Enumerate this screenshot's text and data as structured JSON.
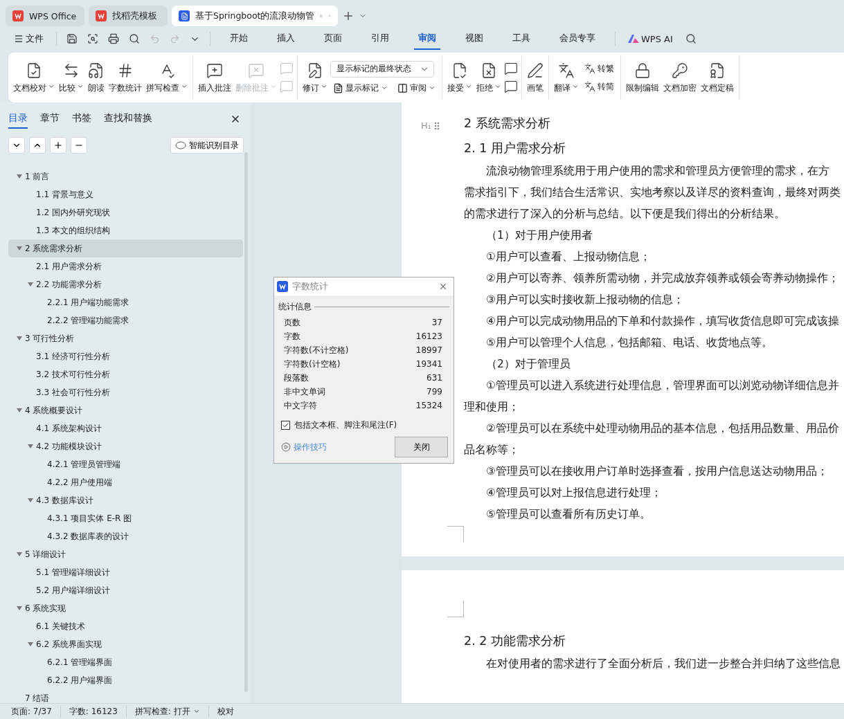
{
  "app_tabs": [
    {
      "label": "WPS Office",
      "kind": "home",
      "selected": false
    },
    {
      "label": "找稻壳模板",
      "kind": "template",
      "selected": false
    },
    {
      "label": "基于Springboot的流浪动物管",
      "kind": "doc",
      "selected": true
    }
  ],
  "menu": {
    "file": "文件",
    "tabs": [
      {
        "label": "开始",
        "selected": false
      },
      {
        "label": "插入",
        "selected": false
      },
      {
        "label": "页面",
        "selected": false
      },
      {
        "label": "引用",
        "selected": false
      },
      {
        "label": "审阅",
        "selected": true
      },
      {
        "label": "视图",
        "selected": false
      },
      {
        "label": "工具",
        "selected": false
      },
      {
        "label": "会员专享",
        "selected": false
      }
    ],
    "ai": "WPS AI"
  },
  "ribbon": [
    {
      "items": [
        {
          "kind": "big",
          "label": "文档校对",
          "dropdown": true,
          "disabled": false
        },
        {
          "kind": "big",
          "label": "比较",
          "dropdown": true,
          "disabled": false
        },
        {
          "kind": "big",
          "label": "朗读",
          "dropdown": false,
          "disabled": false
        },
        {
          "kind": "big",
          "label": "字数统计",
          "dropdown": false,
          "disabled": false
        },
        {
          "kind": "big",
          "label": "拼写检查",
          "dropdown": true,
          "disabled": false
        }
      ]
    },
    {
      "items": [
        {
          "kind": "big",
          "label": "插入批注",
          "dropdown": false,
          "disabled": false
        },
        {
          "kind": "big",
          "label": "删除批注",
          "dropdown": true,
          "disabled": true
        },
        {
          "kind": "pair",
          "disabled": true
        }
      ]
    },
    {
      "items": [
        {
          "kind": "big",
          "label": "修订",
          "dropdown": true,
          "disabled": false
        },
        {
          "kind": "select",
          "value": "显示标记的最终状态",
          "buttons": [
            {
              "label": "显示标记",
              "dropdown": true
            },
            {
              "label": "审阅",
              "dropdown": true
            }
          ]
        }
      ]
    },
    {
      "items": [
        {
          "kind": "big",
          "label": "接受",
          "dropdown": true,
          "disabled": false
        },
        {
          "kind": "big",
          "label": "拒绝",
          "dropdown": true,
          "disabled": false
        },
        {
          "kind": "pair",
          "disabled": false
        }
      ]
    },
    {
      "items": [
        {
          "kind": "big",
          "label": "画笔",
          "dropdown": false,
          "disabled": false
        }
      ]
    },
    {
      "items": [
        {
          "kind": "big",
          "label": "翻译",
          "dropdown": true,
          "disabled": false
        },
        {
          "kind": "stack",
          "buttons": [
            {
              "label": "转繁",
              "dropdown": false
            },
            {
              "label": "转简",
              "dropdown": false
            }
          ]
        }
      ]
    },
    {
      "items": [
        {
          "kind": "big",
          "label": "限制编辑",
          "dropdown": false,
          "disabled": false
        },
        {
          "kind": "big",
          "label": "文档加密",
          "dropdown": false,
          "disabled": false
        },
        {
          "kind": "big",
          "label": "文档定稿",
          "dropdown": false,
          "disabled": false
        }
      ]
    }
  ],
  "nav_panel": {
    "tabs": [
      {
        "label": "目录",
        "selected": true
      },
      {
        "label": "章节",
        "selected": false
      },
      {
        "label": "书签",
        "selected": false
      },
      {
        "label": "查找和替换",
        "selected": false
      }
    ],
    "smart_button": "智能识别目录",
    "toc": [
      {
        "label": "1 前言",
        "expanded": true,
        "selected": false,
        "children": [
          {
            "label": "1.1 背景与意义",
            "selected": false
          },
          {
            "label": "1.2 国内外研究现状",
            "selected": false
          },
          {
            "label": "1.3 本文的组织结构",
            "selected": false
          }
        ]
      },
      {
        "label": "2 系统需求分析",
        "expanded": true,
        "selected": true,
        "children": [
          {
            "label": "2.1 用户需求分析",
            "selected": false
          },
          {
            "label": "2.2 功能需求分析",
            "expanded": true,
            "selected": false,
            "children": [
              {
                "label": "2.2.1 用户端功能需求",
                "selected": false
              },
              {
                "label": "2.2.2 管理端功能需求",
                "selected": false
              }
            ]
          }
        ]
      },
      {
        "label": "3 可行性分析",
        "expanded": true,
        "selected": false,
        "children": [
          {
            "label": "3.1 经济可行性分析",
            "selected": false
          },
          {
            "label": "3.2 技术可行性分析",
            "selected": false
          },
          {
            "label": "3.3 社会可行性分析",
            "selected": false
          }
        ]
      },
      {
        "label": "4 系统概要设计",
        "expanded": true,
        "selected": false,
        "children": [
          {
            "label": "4.1 系统架构设计",
            "selected": false
          },
          {
            "label": "4.2 功能模块设计",
            "expanded": true,
            "selected": false,
            "children": [
              {
                "label": "4.2.1 管理员管理端",
                "selected": false
              },
              {
                "label": "4.2.2 用户使用端",
                "selected": false
              }
            ]
          },
          {
            "label": "4.3 数据库设计",
            "expanded": true,
            "selected": false,
            "children": [
              {
                "label": "4.3.1 项目实体 E-R 图",
                "selected": false
              },
              {
                "label": "4.3.2 数据库表的设计",
                "selected": false
              }
            ]
          }
        ]
      },
      {
        "label": "5 详细设计",
        "expanded": true,
        "selected": false,
        "children": [
          {
            "label": "5.1 管理端详细设计",
            "selected": false
          },
          {
            "label": "5.2 用户端详细设计",
            "selected": false
          }
        ]
      },
      {
        "label": "6  系统实现",
        "expanded": true,
        "selected": false,
        "children": [
          {
            "label": "6.1 关键技术",
            "selected": false
          },
          {
            "label": "6.2 系统界面实现",
            "expanded": true,
            "selected": false,
            "children": [
              {
                "label": "6.2.1 管理端界面",
                "selected": false
              },
              {
                "label": "6.2.2 用户端界面",
                "selected": false
              }
            ]
          }
        ]
      },
      {
        "label": "7 结语",
        "selected": false
      }
    ]
  },
  "document": {
    "heading_marker": "H₁",
    "page1": [
      {
        "kind": "h1",
        "text": "2 系统需求分析"
      },
      {
        "kind": "h2",
        "text": "2. 1 用户需求分析"
      },
      {
        "kind": "indent",
        "text": "流浪动物管理系统用于用户使用的需求和管理员方便管理的需求，在方"
      },
      {
        "kind": "plain",
        "text": "需求指引下，我们结合生活常识、实地考察以及详尽的资料查询，最终对两类"
      },
      {
        "kind": "plain",
        "text": "的需求进行了深入的分析与总结。以下便是我们得出的分析结果。"
      },
      {
        "kind": "indent",
        "text": "（1）对于用户使用者"
      },
      {
        "kind": "indent",
        "text": "①用户可以查看、上报动物信息；"
      },
      {
        "kind": "indent",
        "text": "②用户可以寄养、领养所需动物，并完成放弃领养或领会寄养动物操作；"
      },
      {
        "kind": "indent",
        "text": "③用户可以实时接收新上报动物的信息；"
      },
      {
        "kind": "indent",
        "text": "④用户可以完成动物用品的下单和付款操作，填写收货信息即可完成该操"
      },
      {
        "kind": "indent",
        "text": "⑤用户可以管理个人信息，包括邮箱、电话、收货地点等。"
      },
      {
        "kind": "indent",
        "text": "（2）对于管理员"
      },
      {
        "kind": "indent",
        "text": "①管理员可以进入系统进行处理信息，管理界面可以浏览动物详细信息并"
      },
      {
        "kind": "plain",
        "text": "理和使用；"
      },
      {
        "kind": "indent",
        "text": "②管理员可以在系统中处理动物用品的基本信息，包括用品数量、用品价"
      },
      {
        "kind": "plain",
        "text": "品名称等；"
      },
      {
        "kind": "indent",
        "text": "③管理员可以在接收用户订单时选择查看，按用户信息送达动物用品；"
      },
      {
        "kind": "indent",
        "text": "④管理员可以对上报信息进行处理；"
      },
      {
        "kind": "indent",
        "text": "⑤管理员可以查看所有历史订单。"
      }
    ],
    "page2": [
      {
        "kind": "h2",
        "text": "2. 2 功能需求分析"
      },
      {
        "kind": "indent",
        "text": "在对使用者的需求进行了全面分析后，我们进一步整合并归纳了这些信息"
      }
    ]
  },
  "word_count_dialog": {
    "title": "字数统计",
    "section": "统计信息",
    "rows": [
      {
        "label": "页数",
        "value": "37"
      },
      {
        "label": "字数",
        "value": "16123"
      },
      {
        "label": "字符数(不计空格)",
        "value": "18997"
      },
      {
        "label": "字符数(计空格)",
        "value": "19341"
      },
      {
        "label": "段落数",
        "value": "631"
      },
      {
        "label": "非中文单词",
        "value": "799"
      },
      {
        "label": "中文字符",
        "value": "15324"
      }
    ],
    "include_checkbox": {
      "label": "包括文本框、脚注和尾注(F)",
      "checked": true
    },
    "tips_link": "操作技巧",
    "close_button": "关闭"
  },
  "status_bar": [
    {
      "kind": "text",
      "label": "页面: 7/37"
    },
    {
      "kind": "text",
      "label": "字数: 16123"
    },
    {
      "kind": "dropdown",
      "label": "拼写检查: 打开"
    },
    {
      "kind": "text",
      "label": "校对"
    }
  ]
}
